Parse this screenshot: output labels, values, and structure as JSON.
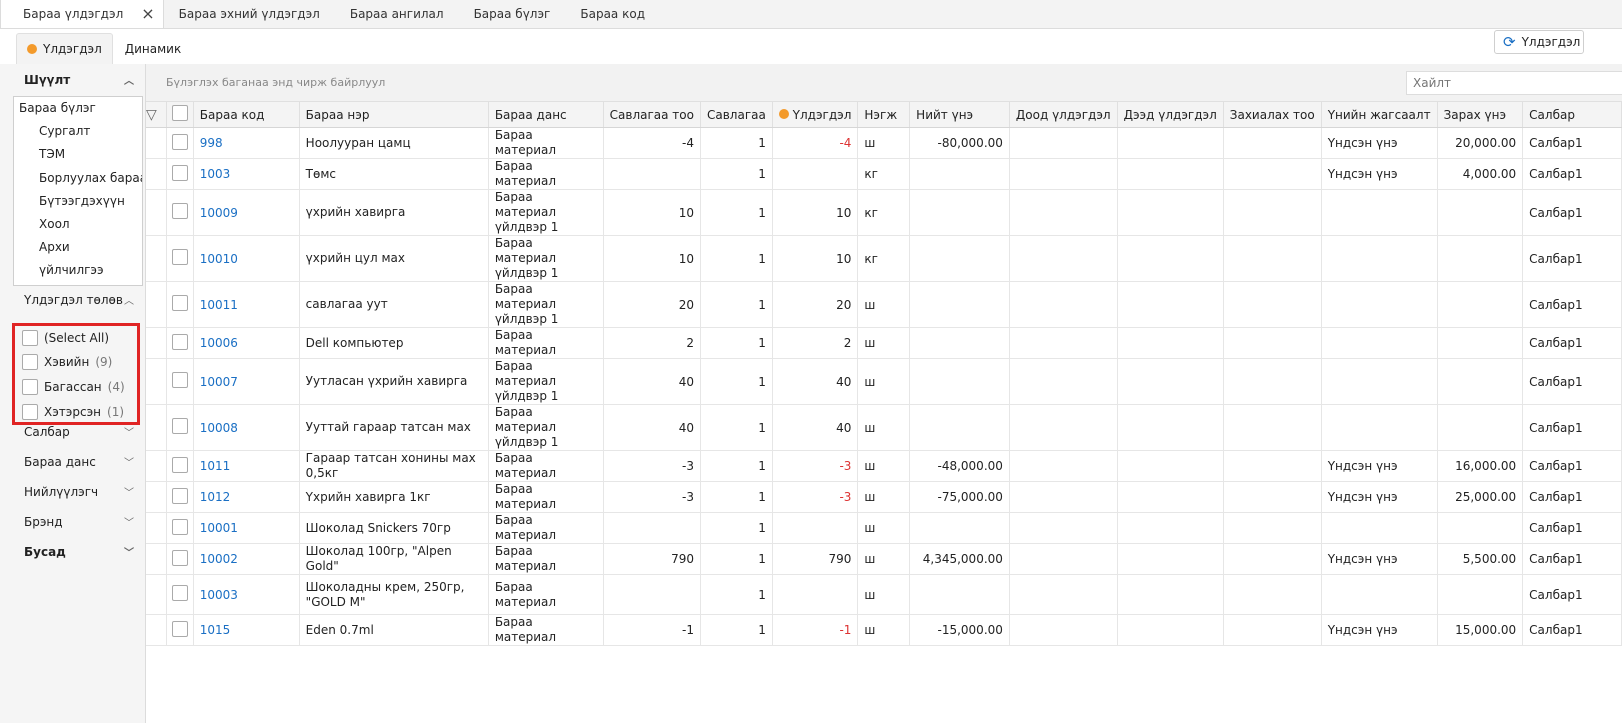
{
  "doc_tabs": [
    {
      "label": "Бараа үлдэгдэл",
      "active": true
    },
    {
      "label": "Бараа эхний үлдэгдэл"
    },
    {
      "label": "Бараа ангилал"
    },
    {
      "label": "Бараа бүлэг"
    },
    {
      "label": "Бараа код"
    }
  ],
  "sub_tabs": [
    {
      "label": "Үлдэгдэл",
      "active": true
    },
    {
      "label": "Динамик"
    }
  ],
  "refresh_label": "Үлдэгдэл",
  "sidebar": {
    "filter_title": "Шүүлт",
    "tree": [
      "Бараа бүлэг",
      "Сургалт",
      "ТЭМ",
      "Борлуулах бараа",
      "Бүтээгдэхүүн",
      "Хоол",
      "Архи",
      "үйлчилгээ"
    ],
    "status_title": "Үлдэгдэл төлөв",
    "status_items": [
      {
        "label": "(Select All)",
        "count": ""
      },
      {
        "label": "Хэвийн",
        "count": "(9)"
      },
      {
        "label": "Багассан",
        "count": "(4)"
      },
      {
        "label": "Хэтэрсэн",
        "count": "(1)"
      }
    ],
    "sections": [
      "Салбар",
      "Бараа данс",
      "Нийлүүлэгч",
      "Брэнд",
      "Бусад"
    ]
  },
  "grid": {
    "group_hint": "Бүлэглэх баганаа энд чирж байрлуул",
    "search_placeholder": "Хайлт",
    "columns": [
      "Бараа код",
      "Бараа нэр",
      "Бараа данс",
      "Савлагаа тоо",
      "Савлагаа",
      "Үлдэгдэл",
      "Нэгж",
      "Нийт үнэ",
      "Доод үлдэгдэл",
      "Дээд үлдэгдэл",
      "Захиалах тоо",
      "Үнийн жагсаалт",
      "Зарах үнэ",
      "Салбар"
    ],
    "rows": [
      [
        "998",
        "Ноолууран цамц",
        "Бараа материал",
        "-4",
        "1",
        "-4",
        "ш",
        "-80,000.00",
        "",
        "",
        "",
        "Үндсэн үнэ",
        "20,000.00",
        "Салбар1"
      ],
      [
        "1003",
        "Төмс",
        "Бараа материал",
        "",
        "1",
        "",
        "кг",
        "",
        "",
        "",
        "",
        "Үндсэн үнэ",
        "4,000.00",
        "Салбар1"
      ],
      [
        "10009",
        "үхрийн хавирга",
        "Бараа материал үйлдвэр 1",
        "10",
        "1",
        "10",
        "кг",
        "",
        "",
        "",
        "",
        "",
        "",
        "Салбар1"
      ],
      [
        "10010",
        "үхрийн цул мах",
        "Бараа материал үйлдвэр 1",
        "10",
        "1",
        "10",
        "кг",
        "",
        "",
        "",
        "",
        "",
        "",
        "Салбар1"
      ],
      [
        "10011",
        "савлагаа уут",
        "Бараа материал үйлдвэр 1",
        "20",
        "1",
        "20",
        "ш",
        "",
        "",
        "",
        "",
        "",
        "",
        "Салбар1"
      ],
      [
        "10006",
        "Dell компьютер",
        "Бараа материал",
        "2",
        "1",
        "2",
        "ш",
        "",
        "",
        "",
        "",
        "",
        "",
        "Салбар1"
      ],
      [
        "10007",
        "Уутласан үхрийн хавирга",
        "Бараа материал үйлдвэр 1",
        "40",
        "1",
        "40",
        "ш",
        "",
        "",
        "",
        "",
        "",
        "",
        "Салбар1"
      ],
      [
        "10008",
        "Ууттай гараар татсан мах",
        "Бараа материал үйлдвэр 1",
        "40",
        "1",
        "40",
        "ш",
        "",
        "",
        "",
        "",
        "",
        "",
        "Салбар1"
      ],
      [
        "1011",
        "Гараар татсан хонины мах 0,5кг",
        "Бараа материал",
        "-3",
        "1",
        "-3",
        "ш",
        "-48,000.00",
        "",
        "",
        "",
        "Үндсэн үнэ",
        "16,000.00",
        "Салбар1"
      ],
      [
        "1012",
        "Үхрийн хавирга 1кг",
        "Бараа материал",
        "-3",
        "1",
        "-3",
        "ш",
        "-75,000.00",
        "",
        "",
        "",
        "Үндсэн үнэ",
        "25,000.00",
        "Салбар1"
      ],
      [
        "10001",
        "Шоколад Snickers 70гр",
        "Бараа материал",
        "",
        "1",
        "",
        "ш",
        "",
        "",
        "",
        "",
        "",
        "",
        "Салбар1"
      ],
      [
        "10002",
        "Шоколад 100гр, \"Alpen Gold\"",
        "Бараа материал",
        "790",
        "1",
        "790",
        "ш",
        "4,345,000.00",
        "",
        "",
        "",
        "Үндсэн үнэ",
        "5,500.00",
        "Салбар1"
      ],
      [
        "10003",
        "Шоколадны крем, 250гр, \"GOLD M\"",
        "Бараа материал",
        "",
        "1",
        "",
        "ш",
        "",
        "",
        "",
        "",
        "",
        "",
        "Салбар1"
      ],
      [
        "1015",
        "Eden 0.7ml",
        "Бараа материал",
        "-1",
        "1",
        "-1",
        "ш",
        "-15,000.00",
        "",
        "",
        "",
        "Үндсэн үнэ",
        "15,000.00",
        "Салбар1"
      ]
    ]
  },
  "colors": {
    "accent": "#1a6fc4",
    "status_dot": "#f39a2b",
    "negative": "#d33333",
    "highlight_border": "#e02424"
  }
}
